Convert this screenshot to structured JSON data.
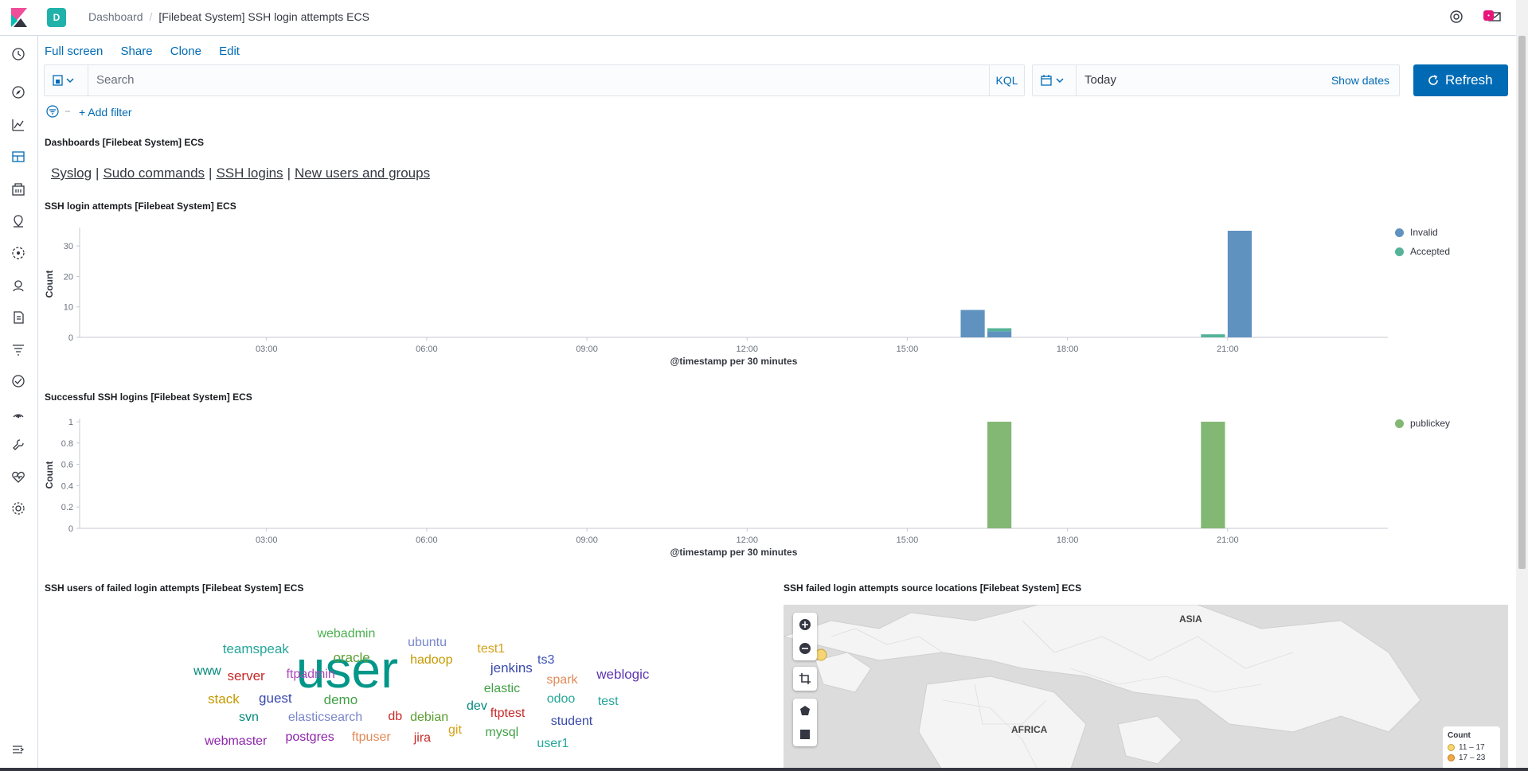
{
  "header": {
    "space_initial": "D",
    "breadcrumb_root": "Dashboard",
    "breadcrumb_sep": "/",
    "breadcrumb_current": "[Filebeat System] SSH login attempts ECS"
  },
  "actions": [
    "Full screen",
    "Share",
    "Clone",
    "Edit"
  ],
  "query": {
    "placeholder": "Search",
    "language": "KQL"
  },
  "date": {
    "value": "Today",
    "show_dates": "Show dates",
    "refresh": "Refresh"
  },
  "filters": {
    "add": "+ Add filter"
  },
  "panels": {
    "links_title": "Dashboards [Filebeat System] ECS",
    "links": [
      "Syslog",
      "Sudo commands",
      "SSH logins",
      "New users and groups"
    ],
    "attempts_title": "SSH login attempts [Filebeat System] ECS",
    "success_title": "Successful SSH logins [Filebeat System] ECS",
    "cloud_title": "SSH users of failed login attempts [Filebeat System] ECS",
    "map_title": "SSH failed login attempts source locations [Filebeat System] ECS"
  },
  "chart_data": [
    {
      "type": "bar",
      "title": "SSH login attempts [Filebeat System] ECS",
      "xlabel": "@timestamp per 30 minutes",
      "ylabel": "Count",
      "x_ticks": [
        "03:00",
        "06:00",
        "09:00",
        "12:00",
        "15:00",
        "18:00",
        "21:00"
      ],
      "y_ticks": [
        0,
        10,
        20,
        30
      ],
      "ylim": [
        0,
        35
      ],
      "stacked": true,
      "legend": "right",
      "series": [
        {
          "name": "Invalid",
          "color": "#6092c0",
          "points": [
            {
              "x": "16:00",
              "y": 9
            },
            {
              "x": "16:30",
              "y": 2
            },
            {
              "x": "20:30",
              "y": 0
            },
            {
              "x": "21:00",
              "y": 35
            }
          ]
        },
        {
          "name": "Accepted",
          "color": "#54b399",
          "points": [
            {
              "x": "16:30",
              "y": 1
            },
            {
              "x": "20:30",
              "y": 1
            }
          ]
        }
      ]
    },
    {
      "type": "bar",
      "title": "Successful SSH logins [Filebeat System] ECS",
      "xlabel": "@timestamp per 30 minutes",
      "ylabel": "Count",
      "x_ticks": [
        "03:00",
        "06:00",
        "09:00",
        "12:00",
        "15:00",
        "18:00",
        "21:00"
      ],
      "y_ticks": [
        0,
        0.2,
        0.4,
        0.6,
        0.8,
        1
      ],
      "ylim": [
        0,
        1
      ],
      "legend": "right",
      "series": [
        {
          "name": "publickey",
          "color": "#82b874",
          "points": [
            {
              "x": "16:30",
              "y": 1
            },
            {
              "x": "20:30",
              "y": 1
            }
          ]
        }
      ]
    }
  ],
  "tag_cloud": [
    {
      "text": "user",
      "color": "#009688",
      "size": 66
    },
    {
      "text": "webadmin",
      "color": "#4caf50",
      "size": 16
    },
    {
      "text": "teamspeak",
      "color": "#26a69a",
      "size": 17
    },
    {
      "text": "ubuntu",
      "color": "#7986cb",
      "size": 16
    },
    {
      "text": "test1",
      "color": "#d4a017",
      "size": 16
    },
    {
      "text": "oracle",
      "color": "#5a9e30",
      "size": 17
    },
    {
      "text": "hadoop",
      "color": "#c49a00",
      "size": 16
    },
    {
      "text": "ts3",
      "color": "#3f51b5",
      "size": 16
    },
    {
      "text": "jenkins",
      "color": "#3949ab",
      "size": 17
    },
    {
      "text": "www",
      "color": "#00897b",
      "size": 16
    },
    {
      "text": "server",
      "color": "#c62828",
      "size": 17
    },
    {
      "text": "ftpadmin",
      "color": "#ab47bc",
      "size": 16
    },
    {
      "text": "weblogic",
      "color": "#5e35b1",
      "size": 17
    },
    {
      "text": "spark",
      "color": "#e08a5a",
      "size": 16
    },
    {
      "text": "elastic",
      "color": "#43a047",
      "size": 16
    },
    {
      "text": "stack",
      "color": "#c49a00",
      "size": 17
    },
    {
      "text": "guest",
      "color": "#3949ab",
      "size": 17
    },
    {
      "text": "demo",
      "color": "#43a047",
      "size": 17
    },
    {
      "text": "odoo",
      "color": "#26a69a",
      "size": 16
    },
    {
      "text": "test",
      "color": "#26a69a",
      "size": 16
    },
    {
      "text": "dev",
      "color": "#00897b",
      "size": 16
    },
    {
      "text": "svn",
      "color": "#00897b",
      "size": 16
    },
    {
      "text": "elasticsearch",
      "color": "#7986cb",
      "size": 16
    },
    {
      "text": "db",
      "color": "#c62828",
      "size": 16
    },
    {
      "text": "debian",
      "color": "#5a9e30",
      "size": 16
    },
    {
      "text": "ftptest",
      "color": "#c62828",
      "size": 16
    },
    {
      "text": "student",
      "color": "#3949ab",
      "size": 16
    },
    {
      "text": "git",
      "color": "#d4a017",
      "size": 16
    },
    {
      "text": "mysql",
      "color": "#43a047",
      "size": 16
    },
    {
      "text": "webmaster",
      "color": "#8e24aa",
      "size": 16
    },
    {
      "text": "postgres",
      "color": "#8e24aa",
      "size": 16
    },
    {
      "text": "ftpuser",
      "color": "#e08a5a",
      "size": 16
    },
    {
      "text": "jira",
      "color": "#c62828",
      "size": 16
    },
    {
      "text": "user1",
      "color": "#26a69a",
      "size": 16
    }
  ],
  "map": {
    "labels": [
      "ASIA",
      "AFRICA"
    ],
    "legend_title": "Count",
    "legend_items": [
      {
        "label": "11 – 17",
        "color": "#f6d574"
      },
      {
        "label": "17 – 23",
        "color": "#f0a94a"
      }
    ]
  }
}
